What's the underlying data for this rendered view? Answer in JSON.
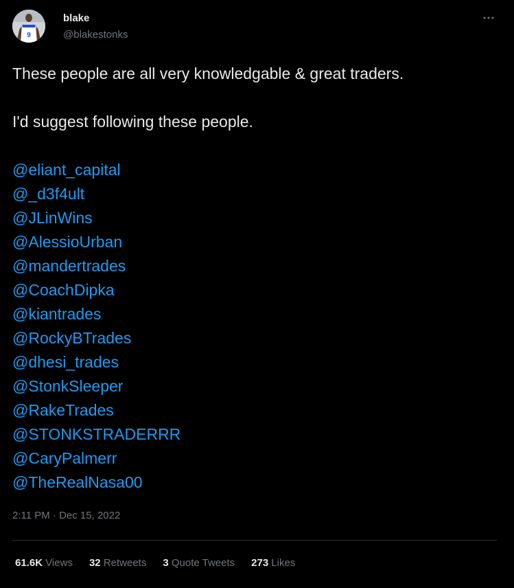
{
  "author": {
    "name": "blake",
    "handle": "@blakestonks",
    "jersey_number": "9"
  },
  "tweet": {
    "line1": "These people are all very knowledgable & great traders.",
    "line2": "I'd suggest following these people.",
    "mentions": [
      "@eliant_capital",
      "@_d3f4ult",
      "@JLinWins",
      "@AlessioUrban",
      "@mandertrades",
      "@CoachDipka",
      "@kiantrades",
      "@RockyBTrades",
      "@dhesi_trades",
      "@StonkSleeper",
      "@RakeTrades",
      "@STONKSTRADERRR",
      "@CaryPalmerr",
      "@TheRealNasa00"
    ],
    "time": "2:11 PM",
    "separator": "·",
    "date": "Dec 15, 2022"
  },
  "stats": {
    "views_count": "61.6K",
    "views_label": "Views",
    "retweets_count": "32",
    "retweets_label": "Retweets",
    "quotes_count": "3",
    "quotes_label": "Quote Tweets",
    "likes_count": "273",
    "likes_label": "Likes"
  },
  "icons": {
    "more": "more-horizontal-icon"
  },
  "colors": {
    "background": "#000000",
    "text_primary": "#e7e9ea",
    "text_secondary": "#71767b",
    "link": "#1d9bf0",
    "divider": "#2f3336"
  }
}
